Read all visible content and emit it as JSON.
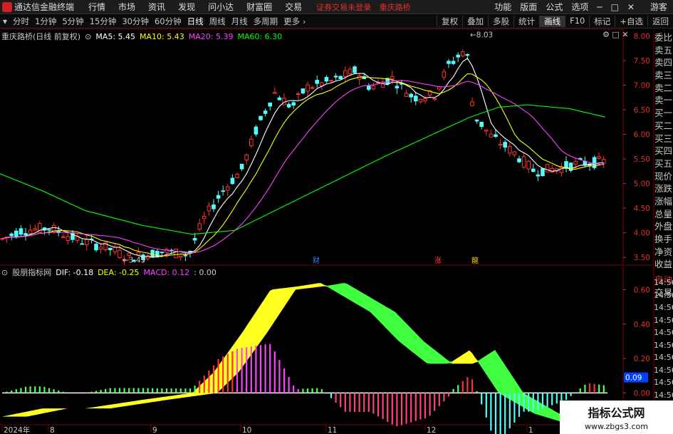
{
  "app": {
    "name": "通达信金融终端",
    "menu": [
      "行情",
      "市场",
      "资讯",
      "发现",
      "问小达",
      "财富圈",
      "交易"
    ],
    "status_warning": "证券交易未登录",
    "status_stock": "重庆路桥",
    "right_menu": [
      "功能",
      "版面",
      "公式",
      "选项"
    ],
    "guest": "游客"
  },
  "periods": {
    "items": [
      "分时",
      "1分钟",
      "5分钟",
      "15分钟",
      "30分钟",
      "60分钟",
      "日线",
      "周线",
      "月线",
      "多周期",
      "更多"
    ],
    "active": "日线"
  },
  "toolbar": [
    "复权",
    "叠加",
    "多股",
    "统计",
    "画线",
    "F10",
    "标记",
    "+自选",
    "返回"
  ],
  "chart_header": {
    "stock_title": "重庆路桥(日线 前复权)",
    "ma5": "MA5: 5.45",
    "ma10": "MA10: 5.43",
    "ma20": "MA20: 5.39",
    "ma60": "MA60: 6.30",
    "ma5_color": "#ffffff",
    "ma10_color": "#ffff00",
    "ma20_color": "#ff40ff",
    "ma60_color": "#00ff00"
  },
  "macd_header": {
    "name": "股朋指标网",
    "dif": "DIF: -0.18",
    "dea": "DEA: -0.25",
    "macd": "MACD: 0.12",
    "extra": ": 0.00"
  },
  "sidebar": [
    "委比",
    "卖五",
    "卖四",
    "卖三",
    "卖二",
    "卖一",
    "买一",
    "买二",
    "买三",
    "买四",
    "买五",
    "现价",
    "涨跌",
    "涨幅",
    "总量",
    "外盘",
    "换手",
    "净资",
    "收益"
  ],
  "sidebar2": [
    "自动",
    "交易"
  ],
  "time_col": [
    "14:56",
    "14:56",
    "14:56",
    "14:56",
    "14:56",
    "14:56",
    "14:56",
    "14:56",
    "14:56",
    "14:56"
  ],
  "markers": {
    "cai": "财",
    "zhang": "涨",
    "long": "龍"
  },
  "watermark": {
    "title": "指标公式网",
    "url": "www.zbgs3.com"
  },
  "chart_data": {
    "type": "candlestick",
    "price_axis": {
      "ylim": [
        3.3,
        8.15
      ],
      "ticks": [
        "8.00",
        "7.50",
        "7.00",
        "6.50",
        "6.00",
        "5.50",
        "5.00",
        "4.50",
        "4.00",
        "3.50"
      ]
    },
    "high_label": "8.03",
    "low_label": "3.45",
    "macd_axis": {
      "ylim": [
        -0.16,
        0.66
      ],
      "ticks": [
        "0.60",
        "0.40",
        "0.20",
        "0.00"
      ],
      "current": "0.09"
    },
    "x_labels": [
      "2024年",
      "8",
      "9",
      "10",
      "11",
      "12",
      "1"
    ],
    "ma60": [
      [
        0,
        5.2
      ],
      [
        60,
        4.85
      ],
      [
        120,
        4.45
      ],
      [
        200,
        4.15
      ],
      [
        270,
        3.97
      ],
      [
        330,
        4.05
      ],
      [
        400,
        4.55
      ],
      [
        470,
        5.05
      ],
      [
        540,
        5.55
      ],
      [
        600,
        5.95
      ],
      [
        660,
        6.35
      ],
      [
        700,
        6.55
      ],
      [
        740,
        6.6
      ],
      [
        800,
        6.52
      ],
      [
        850,
        6.35
      ]
    ]
  }
}
